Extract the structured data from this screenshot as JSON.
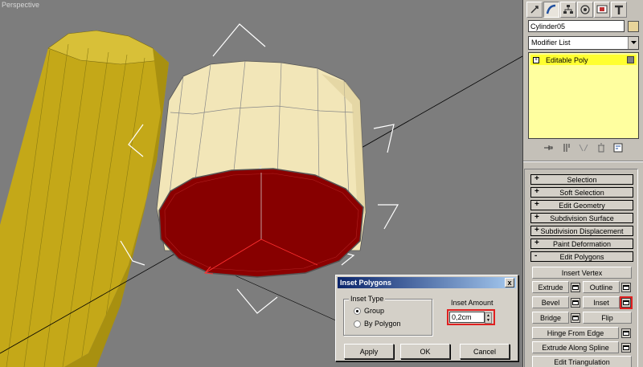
{
  "viewport": {
    "label": "Perspective"
  },
  "command_panel": {
    "tabs": [
      "create-icon",
      "modify-icon",
      "hierarchy-icon",
      "motion-icon",
      "display-icon",
      "utilities-icon"
    ],
    "object_name": "Cylinder05",
    "object_color": "#e8d49a",
    "modifier_list": "Modifier List",
    "stack_item": "Editable Poly",
    "rollouts": [
      {
        "sign": "+",
        "label": "Selection"
      },
      {
        "sign": "+",
        "label": "Soft Selection"
      },
      {
        "sign": "+",
        "label": "Edit Geometry"
      },
      {
        "sign": "+",
        "label": "Subdivision Surface"
      },
      {
        "sign": "+",
        "label": "Subdivision Displacement"
      },
      {
        "sign": "+",
        "label": "Paint Deformation"
      },
      {
        "sign": "-",
        "label": "Edit Polygons"
      }
    ],
    "edit_polygons": {
      "insert_vertex": "Insert Vertex",
      "extrude": "Extrude",
      "outline": "Outline",
      "bevel": "Bevel",
      "inset": "Inset",
      "bridge": "Bridge",
      "flip": "Flip",
      "hinge_from_edge": "Hinge From Edge",
      "extrude_along_spline": "Extrude Along Spline",
      "edit_triangulation": "Edit Triangulation"
    }
  },
  "dialog": {
    "title": "Inset Polygons",
    "close": "x",
    "inset_type_label": "Inset Type",
    "option_group": "Group",
    "option_by_polygon": "By Polygon",
    "inset_amount_label": "Inset Amount",
    "inset_amount_value": "0,2cm",
    "apply": "Apply",
    "ok": "OK",
    "cancel": "Cancel"
  },
  "colors": {
    "viewport_bg": "#7d7d7d",
    "selected_face": "#8b0000",
    "cylinder_side": "#f2e6b8",
    "background_cylinder": "#c8b020",
    "highlight": "#e02020"
  }
}
